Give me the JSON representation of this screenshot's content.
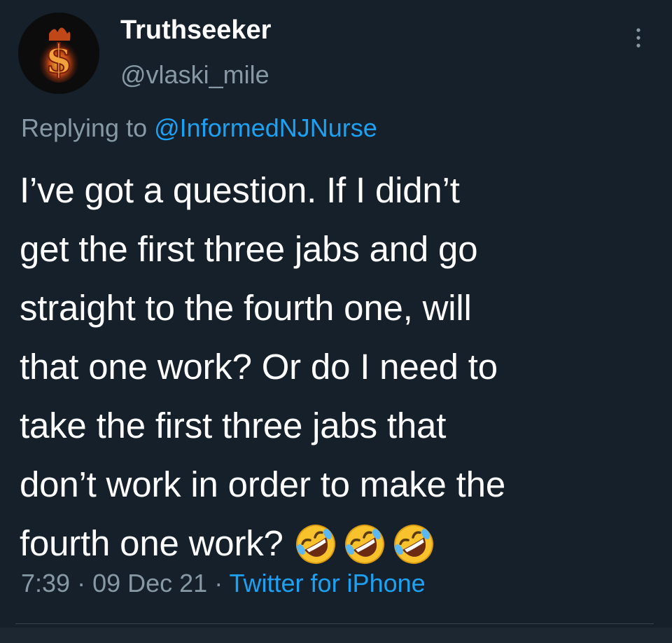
{
  "tweet": {
    "display_name": "Truthseeker",
    "handle": "@vlaski_mile",
    "replying_prefix": "Replying to",
    "reply_mention": "@InformedNJNurse",
    "body_lines": [
      "I’ve got a question. If I didn’t",
      "get the first three jabs and go",
      "straight to the fourth one, will",
      "that one work? Or do I need to",
      "take the first three jabs that",
      "don’t work in order to make the",
      "fourth one work?"
    ],
    "emojis": [
      "rolling-on-floor-laughing",
      "rolling-on-floor-laughing",
      "rolling-on-floor-laughing"
    ],
    "time": "7:39",
    "separator": " · ",
    "date": "09 Dec 21",
    "source": "Twitter for iPhone"
  },
  "icons": {
    "avatar": "dollar-sign-fire-avatar",
    "more": "more-vertical-icon"
  },
  "colors": {
    "background": "#15202b",
    "text": "#ffffff",
    "secondary": "#8899a6",
    "accent": "#1da1f2",
    "divider": "#38444d"
  }
}
